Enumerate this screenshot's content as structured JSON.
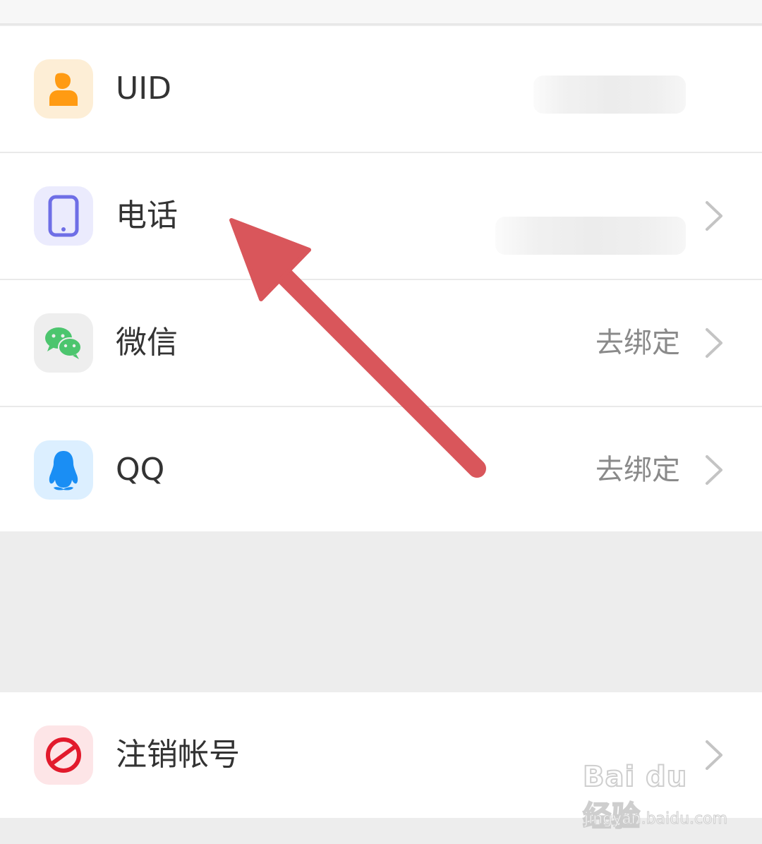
{
  "rows": [
    {
      "label": "UID",
      "value": "",
      "icon": "person-icon",
      "has_chevron": false
    },
    {
      "label": "电话",
      "value": "",
      "icon": "phone-icon",
      "has_chevron": true
    },
    {
      "label": "微信",
      "value": "去绑定",
      "icon": "wechat-icon",
      "has_chevron": true
    },
    {
      "label": "QQ",
      "value": "去绑定",
      "icon": "qq-penguin-icon",
      "has_chevron": true
    }
  ],
  "cancel_account": {
    "label": "注销帐号",
    "icon": "prohibit-icon",
    "has_chevron": true
  },
  "watermark": {
    "brand": "Bai du 经验",
    "url": "jingyan.baidu.com"
  },
  "colors": {
    "uid_icon_bg": "#fdeed6",
    "uid_icon": "#ff9b13",
    "phone_icon_bg": "#ebebfd",
    "phone_icon": "#6e6ee6",
    "wechat_icon_bg": "#eeeeee",
    "wechat_icon": "#4cc56e",
    "qq_icon_bg": "#dcefff",
    "qq_icon": "#1a8ef4",
    "cancel_icon_bg": "#fde5e7",
    "cancel_icon": "#e21a2c",
    "annotation_arrow": "#d9565b"
  }
}
